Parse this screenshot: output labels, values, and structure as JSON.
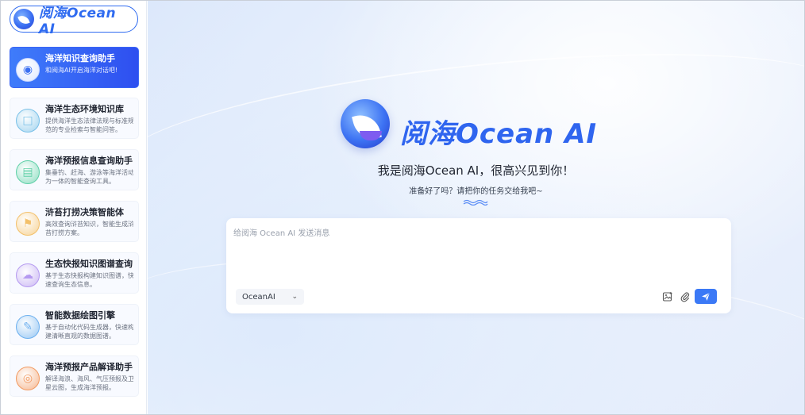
{
  "brand": {
    "name": "阅海Ocean AI"
  },
  "sidebar": {
    "items": [
      {
        "title": "海洋知识查询助手",
        "desc": "和阅海AI开启海洋对话吧!",
        "icon": "robot-icon",
        "color": "#eef3ff",
        "active": true
      },
      {
        "title": "海洋生态环境知识库",
        "desc": "提供海洋生态法律法规与标准规范的专业检索与智能问答。",
        "icon": "book-icon",
        "color": "#7ac1e8"
      },
      {
        "title": "海洋预报信息查询助手",
        "desc": "集垂钓、赶海、游泳等海洋活动为一体的智能查询工具。",
        "icon": "layers-icon",
        "color": "#5fd0a8"
      },
      {
        "title": "浒苔打捞决策智能体",
        "desc": "高效查询浒苔知识，智能生成浒苔打捞方案。",
        "icon": "flag-icon",
        "color": "#f3c06a"
      },
      {
        "title": "生态快报知识图谱查询",
        "desc": "基于生态快报构建知识图谱，快速查询生态信息。",
        "icon": "cloud-icon",
        "color": "#b59af0"
      },
      {
        "title": "智能数据绘图引擎",
        "desc": "基于自动化代码生成器，快速构建清晰直观的数据图谱。",
        "icon": "edit-icon",
        "color": "#6db0ef"
      },
      {
        "title": "海洋预报产品解译助手",
        "desc": "解译海浪、海风、气压预报及卫星云图，生成海洋预报。",
        "icon": "target-icon",
        "color": "#f29a62"
      }
    ]
  },
  "main": {
    "hero_title": "阅海Ocean AI",
    "greeting": "我是阅海Ocean AI，很高兴见到你！",
    "subtitle": "准备好了吗？请把你的任务交给我吧~",
    "input_placeholder": "给阅海 Ocean AI 发送消息",
    "model": "OceanAI"
  },
  "colors": {
    "accent": "#2f6bf0",
    "send": "#3b79f6"
  }
}
